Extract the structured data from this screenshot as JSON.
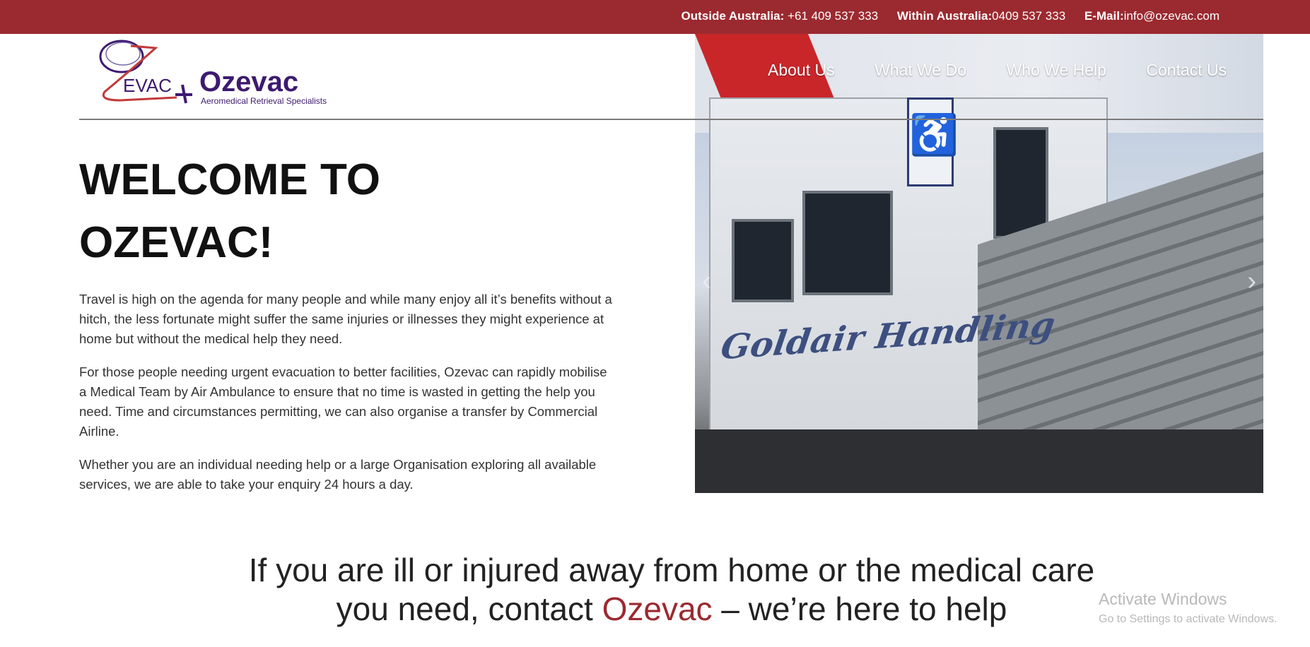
{
  "topbar": {
    "outside_label": "Outside Australia:",
    "outside_value": " +61 409 537 333",
    "within_label": "Within Australia:",
    "within_value": "0409 537 333",
    "email_label": "E-Mail:",
    "email_value": "info@ozevac.com",
    "bg_color": "#9b2a30"
  },
  "logo": {
    "mark_text": "EVAC",
    "brand": "Ozevac",
    "tagline": "Aeromedical Retrieval Specialists"
  },
  "nav": {
    "items": [
      "About Us",
      "What We Do",
      "Who We Help",
      "Contact Us"
    ]
  },
  "hero": {
    "truck_text": "Goldair Handling",
    "prev_label": "‹",
    "next_label": "›"
  },
  "content": {
    "heading_line1": "WELCOME TO",
    "heading_line2": "OZEVAC!",
    "para1": "Travel is high on the agenda for many people and while many enjoy all it’s benefits without a hitch, the less fortunate might suffer the same injuries or illnesses they might experience at home but without the medical help they need.",
    "para2": "For those people needing urgent evacuation to better facilities, Ozevac can rapidly mobilise a Medical Team by Air Ambulance to ensure that no time is wasted in getting the help you need. Time and circumstances permitting, we can also organise a transfer by Commercial Airline.",
    "para3": "Whether you are an individual needing help or a large Organisation exploring all available services, we are able to take your enquiry 24 hours a day."
  },
  "cta": {
    "line1": "If you are ill or injured away from home or the medical care",
    "line2_pre": "you need, contact ",
    "line2_accent": "Ozevac",
    "line2_post": " – we’re here to help",
    "accent_color": "#9b2a30"
  },
  "watermark": {
    "title": "Activate Windows",
    "subtitle": "Go to Settings to activate Windows."
  }
}
